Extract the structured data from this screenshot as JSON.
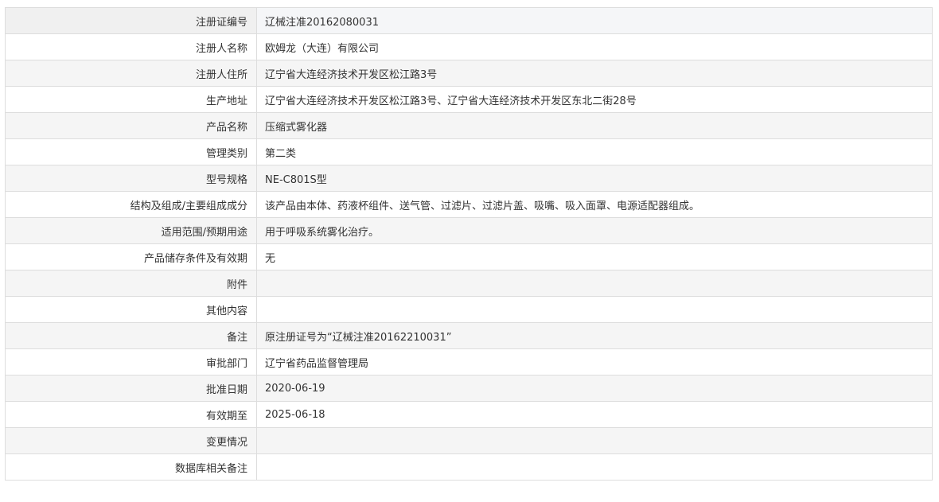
{
  "record": {
    "rows": [
      {
        "label": "注册证编号",
        "value": "辽械注准20162080031"
      },
      {
        "label": "注册人名称",
        "value": "欧姆龙（大连）有限公司"
      },
      {
        "label": "注册人住所",
        "value": "辽宁省大连经济技术开发区松江路3号"
      },
      {
        "label": "生产地址",
        "value": "辽宁省大连经济技术开发区松江路3号、辽宁省大连经济技术开发区东北二街28号"
      },
      {
        "label": "产品名称",
        "value": "压缩式雾化器"
      },
      {
        "label": "管理类别",
        "value": "第二类"
      },
      {
        "label": "型号规格",
        "value": "NE-C801S型"
      },
      {
        "label": "结构及组成/主要组成成分",
        "value": "该产品由本体、药液杯组件、送气管、过滤片、过滤片盖、吸嘴、吸入面罩、电源适配器组成。"
      },
      {
        "label": "适用范围/预期用途",
        "value": "用于呼吸系统雾化治疗。"
      },
      {
        "label": "产品储存条件及有效期",
        "value": "无"
      },
      {
        "label": "附件",
        "value": ""
      },
      {
        "label": "其他内容",
        "value": ""
      },
      {
        "label": "备注",
        "value": "原注册证号为“辽械注准20162210031”"
      },
      {
        "label": "审批部门",
        "value": "辽宁省药品监督管理局"
      },
      {
        "label": "批准日期",
        "value": "2020-06-19"
      },
      {
        "label": "有效期至",
        "value": "2025-06-18"
      },
      {
        "label": "变更情况",
        "value": ""
      },
      {
        "label": "数据库相关备注",
        "value": ""
      }
    ]
  }
}
